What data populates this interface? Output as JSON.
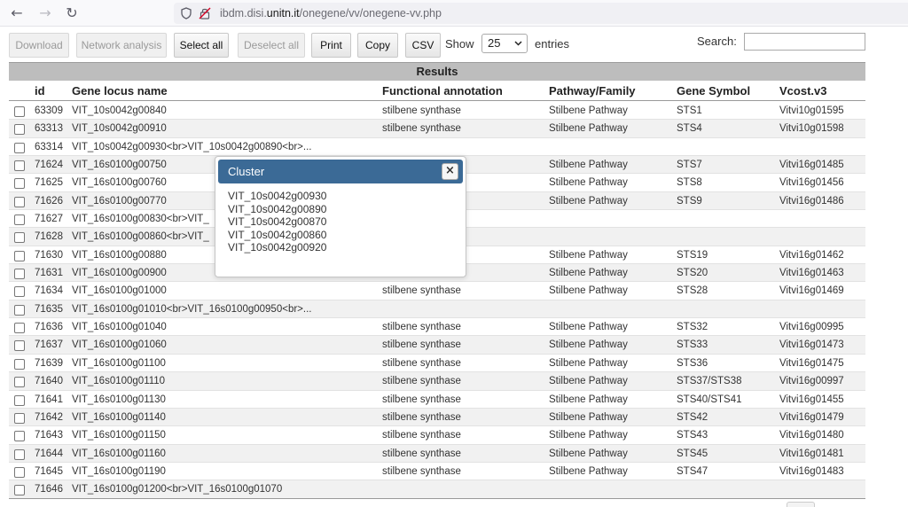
{
  "browser": {
    "back_icon": "←",
    "forward_icon": "→",
    "reload_icon": "↻",
    "url_host_prefix": "ibdm.disi.",
    "url_host_main": "unitn.it",
    "url_path": "/onegene/vv/onegene-vv.php"
  },
  "toolbar": {
    "download": "Download",
    "network": "Network analysis",
    "select_all": "Select all",
    "deselect_all": "Deselect all",
    "print": "Print",
    "copy": "Copy",
    "csv": "CSV",
    "show": "Show",
    "entries_value": "25",
    "entries": "entries",
    "search": "Search:",
    "search_value": ""
  },
  "table": {
    "title": "Results",
    "columns": [
      "id",
      "Gene locus name",
      "Functional annotation",
      "Pathway/Family",
      "Gene Symbol",
      "Vcost.v3"
    ],
    "rows": [
      {
        "id": "63309",
        "locus": "VIT_10s0042g00840",
        "func": "stilbene synthase",
        "path": "Stilbene Pathway",
        "sym": "STS1",
        "vcost": "Vitvi10g01595"
      },
      {
        "id": "63313",
        "locus": "VIT_10s0042g00910",
        "func": "stilbene synthase",
        "path": "Stilbene Pathway",
        "sym": "STS4",
        "vcost": "Vitvi10g01598"
      },
      {
        "id": "63314",
        "locus": "VIT_10s0042g00930<br>VIT_10s0042g00890<br>...",
        "func": "",
        "path": "",
        "sym": "",
        "vcost": ""
      },
      {
        "id": "71624",
        "locus": "VIT_16s0100g00750",
        "func": "",
        "path": "Stilbene Pathway",
        "sym": "STS7",
        "vcost": "Vitvi16g01485"
      },
      {
        "id": "71625",
        "locus": "VIT_16s0100g00760",
        "func": "",
        "path": "Stilbene Pathway",
        "sym": "STS8",
        "vcost": "Vitvi16g01456"
      },
      {
        "id": "71626",
        "locus": "VIT_16s0100g00770",
        "func": "",
        "path": "Stilbene Pathway",
        "sym": "STS9",
        "vcost": "Vitvi16g01486"
      },
      {
        "id": "71627",
        "locus": "VIT_16s0100g00830<br>VIT_",
        "func": "",
        "path": "",
        "sym": "",
        "vcost": ""
      },
      {
        "id": "71628",
        "locus": "VIT_16s0100g00860<br>VIT_",
        "func": "",
        "path": "",
        "sym": "",
        "vcost": ""
      },
      {
        "id": "71630",
        "locus": "VIT_16s0100g00880",
        "func": "",
        "path": "Stilbene Pathway",
        "sym": "STS19",
        "vcost": "Vitvi16g01462"
      },
      {
        "id": "71631",
        "locus": "VIT_16s0100g00900",
        "func": "",
        "path": "Stilbene Pathway",
        "sym": "STS20",
        "vcost": "Vitvi16g01463"
      },
      {
        "id": "71634",
        "locus": "VIT_16s0100g01000",
        "func": "stilbene synthase",
        "path": "Stilbene Pathway",
        "sym": "STS28",
        "vcost": "Vitvi16g01469"
      },
      {
        "id": "71635",
        "locus": "VIT_16s0100g01010<br>VIT_16s0100g00950<br>...",
        "func": "",
        "path": "",
        "sym": "",
        "vcost": ""
      },
      {
        "id": "71636",
        "locus": "VIT_16s0100g01040",
        "func": "stilbene synthase",
        "path": "Stilbene Pathway",
        "sym": "STS32",
        "vcost": "Vitvi16g00995"
      },
      {
        "id": "71637",
        "locus": "VIT_16s0100g01060",
        "func": "stilbene synthase",
        "path": "Stilbene Pathway",
        "sym": "STS33",
        "vcost": "Vitvi16g01473"
      },
      {
        "id": "71639",
        "locus": "VIT_16s0100g01100",
        "func": "stilbene synthase",
        "path": "Stilbene Pathway",
        "sym": "STS36",
        "vcost": "Vitvi16g01475"
      },
      {
        "id": "71640",
        "locus": "VIT_16s0100g01110",
        "func": "stilbene synthase",
        "path": "Stilbene Pathway",
        "sym": "STS37/STS38",
        "vcost": "Vitvi16g00997"
      },
      {
        "id": "71641",
        "locus": "VIT_16s0100g01130",
        "func": "stilbene synthase",
        "path": "Stilbene Pathway",
        "sym": "STS40/STS41",
        "vcost": "Vitvi16g01455"
      },
      {
        "id": "71642",
        "locus": "VIT_16s0100g01140",
        "func": "stilbene synthase",
        "path": "Stilbene Pathway",
        "sym": "STS42",
        "vcost": "Vitvi16g01479"
      },
      {
        "id": "71643",
        "locus": "VIT_16s0100g01150",
        "func": "stilbene synthase",
        "path": "Stilbene Pathway",
        "sym": "STS43",
        "vcost": "Vitvi16g01480"
      },
      {
        "id": "71644",
        "locus": "VIT_16s0100g01160",
        "func": "stilbene synthase",
        "path": "Stilbene Pathway",
        "sym": "STS45",
        "vcost": "Vitvi16g01481"
      },
      {
        "id": "71645",
        "locus": "VIT_16s0100g01190",
        "func": "stilbene synthase",
        "path": "Stilbene Pathway",
        "sym": "STS47",
        "vcost": "Vitvi16g01483"
      },
      {
        "id": "71646",
        "locus": "VIT_16s0100g01200<br>VIT_16s0100g01070",
        "func": "",
        "path": "",
        "sym": "",
        "vcost": ""
      }
    ]
  },
  "modal": {
    "title": "Cluster",
    "close_icon": "×",
    "lines": [
      "VIT_10s0042g00930",
      "VIT_10s0042g00890",
      "VIT_10s0042g00870",
      "VIT_10s0042g00860",
      "VIT_10s0042g00920"
    ]
  }
}
